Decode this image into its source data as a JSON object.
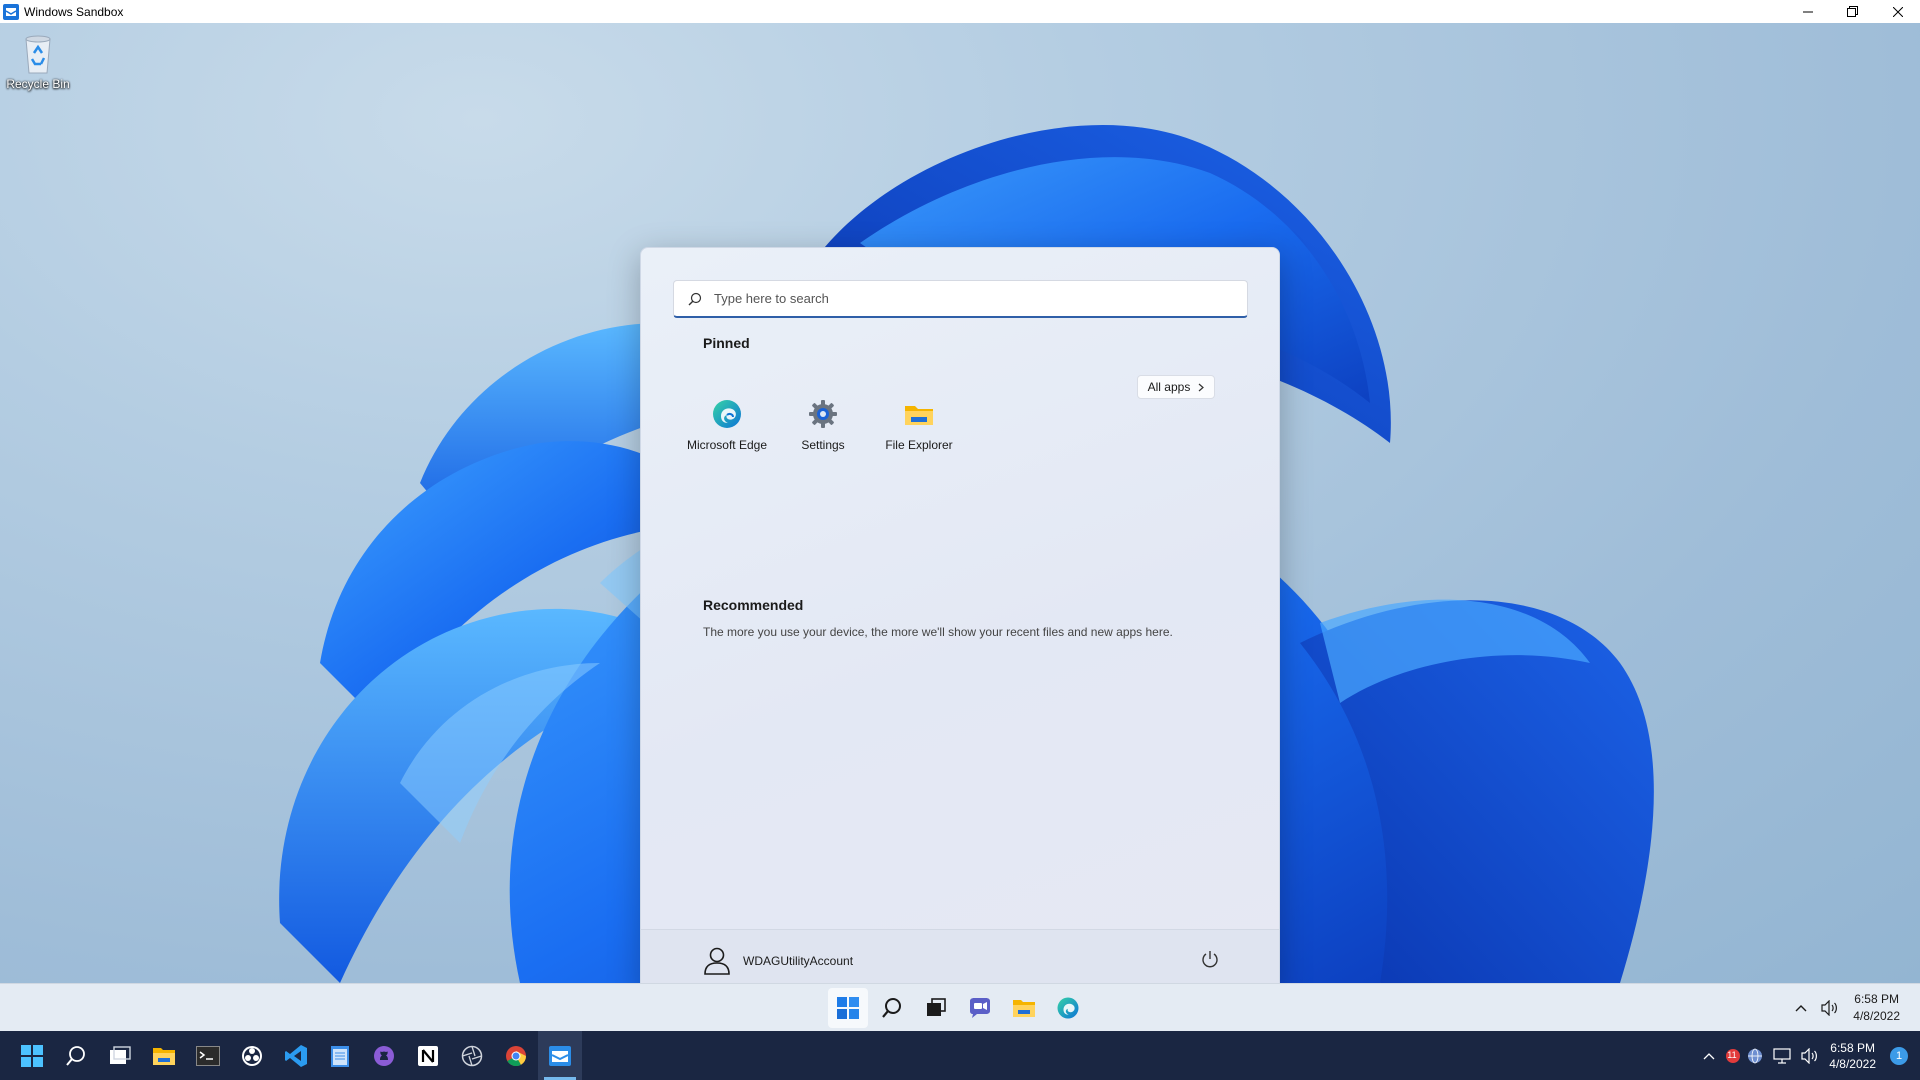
{
  "window": {
    "title": "Windows Sandbox",
    "controls": [
      "minimize",
      "restore",
      "close"
    ]
  },
  "desktop": {
    "icons": [
      {
        "label": "Recycle Bin",
        "icon": "recycle-bin-icon"
      }
    ]
  },
  "start_menu": {
    "search_placeholder": "Type here to search",
    "pinned_title": "Pinned",
    "all_apps_label": "All apps",
    "pinned": [
      {
        "label": "Microsoft Edge",
        "icon": "edge-icon"
      },
      {
        "label": "Settings",
        "icon": "settings-gear-icon"
      },
      {
        "label": "File Explorer",
        "icon": "folder-icon"
      }
    ],
    "recommended_title": "Recommended",
    "recommended_text": "The more you use your device, the more we'll show your recent files and new apps here.",
    "user_name": "WDAGUtilityAccount",
    "power_icon": "power-icon"
  },
  "sandbox_taskbar": {
    "apps": [
      "start-icon",
      "search-icon",
      "task-view-icon",
      "chat-icon",
      "file-explorer-icon",
      "edge-icon"
    ],
    "time": "6:58 PM",
    "date": "4/8/2022"
  },
  "host_taskbar": {
    "apps": [
      "start-icon",
      "search-icon",
      "task-view-icon",
      "file-explorer-icon",
      "terminal-icon",
      "obs-icon",
      "vscode-icon",
      "notepad-icon",
      "github-desktop-icon",
      "notion-icon",
      "camera-aperture-icon",
      "chrome-icon",
      "sandbox-icon"
    ],
    "time": "6:58 PM",
    "date": "4/8/2022",
    "tray_badge": "11",
    "notification_count": "1"
  },
  "colors": {
    "accent": "#2f5fa8",
    "host_taskbar": "#1a2642",
    "wallpaper_blue": "#1d6ff0"
  }
}
